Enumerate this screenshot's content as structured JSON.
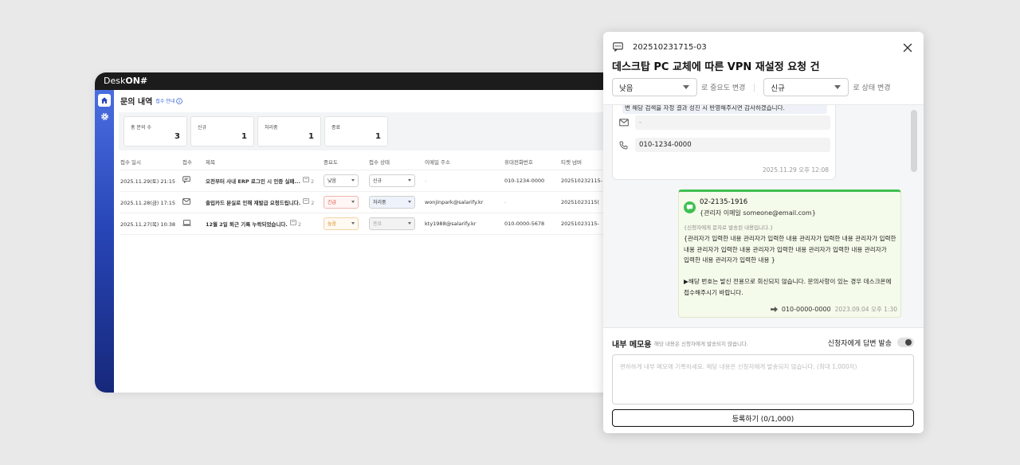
{
  "app": {
    "brand_prefix": "Desk",
    "brand_suffix": "ON#",
    "page_title": "문의 내역",
    "guide_link": "접수 안내",
    "stats": [
      {
        "label": "총 문의 수",
        "value": "3"
      },
      {
        "label": "신규",
        "value": "1"
      },
      {
        "label": "처리중",
        "value": "1"
      },
      {
        "label": "종료",
        "value": "1"
      }
    ],
    "columns": [
      "접수 일시",
      "접수",
      "제목",
      "중요도",
      "접수 상태",
      "이메일 주소",
      "휴대전화번호",
      "티켓 넘버"
    ],
    "rows": [
      {
        "date": "2025.11.29(토) 21:15",
        "channel_icon": "chat-icon",
        "subject": "오전부터 사내 ERP 로그인 시 인증 실패...",
        "count": "2",
        "priority": "낮음",
        "status": "신규",
        "email": "-",
        "phone": "010-1234-0000",
        "ticket": "202510232115-"
      },
      {
        "date": "2025.11.28(금) 17:15",
        "channel_icon": "mail-icon",
        "subject": "출입카드 분실로 인해 재발급 요청드립니다.",
        "count": "2",
        "priority": "긴급",
        "status": "처리중",
        "email": "wonjinpark@salarify.kr",
        "phone": "-",
        "ticket": "20251023115("
      },
      {
        "date": "2025.11.27(목) 10:38",
        "channel_icon": "device-icon",
        "subject": "12월 2일 퇴근 기록 누락되었습니다.",
        "count": "2",
        "priority": "높음",
        "status": "종료",
        "email": "kty1988@salarify.kr",
        "phone": "010-0000-5678",
        "ticket": "20251023115-"
      }
    ]
  },
  "panel": {
    "ticket_id": "202510231715-03",
    "title": "데스크탑 PC 교체에 따른 VPN 재설정 요청 건",
    "priority_value": "낮음",
    "priority_suffix": "로 중요도 변경",
    "status_value": "신규",
    "status_suffix": "로 상태 변경",
    "message1": {
      "cut_text": "변 해당 검색을 자정 결과 성진 시 반영해주시면 감사하겠습니다.",
      "email": "-",
      "phone": "010-1234-0000",
      "time": "2025.11.29 오후 12:08"
    },
    "message2": {
      "tel": "02-2135-1916",
      "sender": "{관리자 이메일 someone@email.com}",
      "note": "{신청자에게 문자로 발송된 내용입니다.}",
      "body": "{관리자가 입력한 내용 관리자가 입력한 내용 관리자가 입력한 내용 관리자가 입력한 내용 관리자가 입력한 내용 관리자가 입력한 내용 관리자가 입력한 내용 관리자가 입력한 내용 관리자가 입력한 내용 }\n\n▶해당 번호는 발신 전용으로 회신되지 않습니다. 문의사항이 있는 경우 데스크온에 접수해주시기 바랍니다.",
      "to": "010-0000-0000",
      "time": "2023.09.04 오후 1:30"
    },
    "memo": {
      "title": "내부 메모용",
      "note": "해당 내용은 신청자에게 발송되지 않습니다.",
      "toggle_label": "신청자에게 답변 발송",
      "placeholder": "편하하게 내부 메모에 기록하세요. 해당 내용은 신청자에게 발송되지 않습니다. (최대 1,000자)",
      "submit": "등록하기 (0/1,000)"
    }
  }
}
